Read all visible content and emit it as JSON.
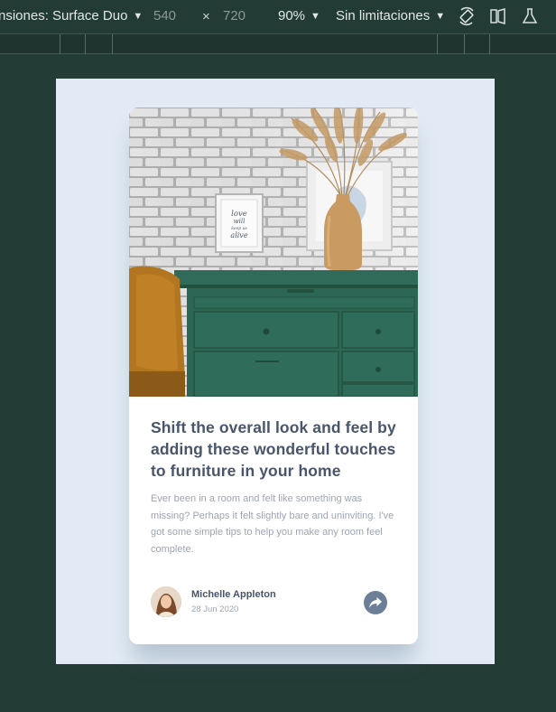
{
  "toolbar": {
    "device_label": "nsiones: Surface Duo",
    "width": "540",
    "times": "×",
    "height": "720",
    "zoom": "90%",
    "throttle": "Sin limitaciones",
    "icons": [
      "caret-down-icon",
      "rotate-icon",
      "dual-screen-icon",
      "flask-icon"
    ]
  },
  "article": {
    "title": "Shift the overall look and feel by adding these wonderful touches to furniture in your home",
    "description": "Ever been in a room and felt like something was missing? Perhaps it felt slightly bare and uninviting. I've got some simple tips to help you make any room feel complete.",
    "author_name": "Michelle Appleton",
    "date": "28 Jun 2020",
    "frame_text": [
      "love",
      "will",
      "keep us",
      "alive"
    ]
  },
  "colors": {
    "page_bg": "#243c36",
    "viewport_bg": "#e2ebf5",
    "heading": "#48556a",
    "body_text": "#9ea5b2",
    "share_button": "#6d7f97",
    "drawer_green": "#2f6b58"
  }
}
